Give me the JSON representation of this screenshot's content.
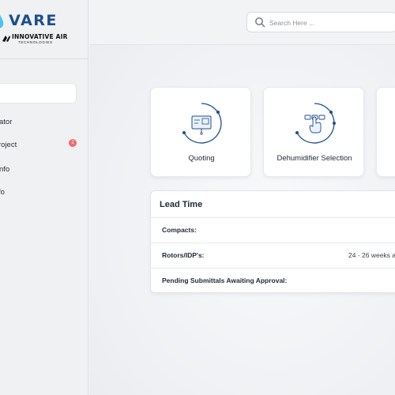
{
  "brand": {
    "logo_text": "VARE",
    "sub_company": "INNOVATIVE AIR",
    "sub_tag": "TECHNOLOGIES",
    "colors": {
      "primary": "#1d4e8f",
      "drop": "#2f8fd8"
    }
  },
  "sidebar": {
    "items": [
      {
        "label": "ator"
      },
      {
        "label": "roject",
        "badge": "2"
      },
      {
        "label": "nfo"
      },
      {
        "label": "fo"
      }
    ]
  },
  "header": {
    "search_placeholder": "Search Here ..."
  },
  "cards": [
    {
      "title": "Quoting",
      "icon": "presentation-board-icon"
    },
    {
      "title": "Dehumidifier Selection",
      "icon": "touch-keypad-icon"
    }
  ],
  "lead_time": {
    "title": "Lead Time",
    "rows": [
      {
        "label": "Compacts:",
        "value": ""
      },
      {
        "label": "Rotors/IDP's:",
        "value": "24 - 26 weeks a"
      },
      {
        "label": "Pending Submittals Awaiting Approval:",
        "value": ""
      }
    ]
  },
  "colors": {
    "accent": "#1d4e8f",
    "badge": "#ef6b6b"
  }
}
